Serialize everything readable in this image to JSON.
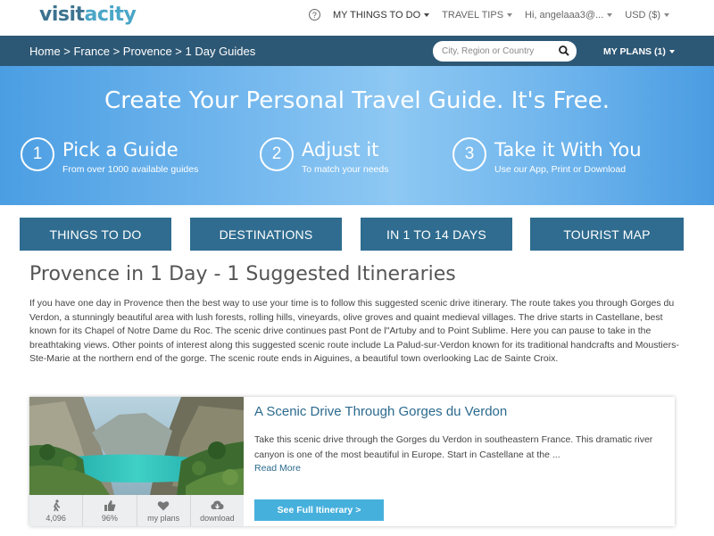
{
  "header": {
    "logo_part1": "visit",
    "logo_part2": "acity",
    "help_icon_glyph": "?",
    "my_things": "MY THINGS TO DO",
    "travel_tips": "TRAVEL TIPS",
    "user": "Hi, angelaaa3@...",
    "currency": "USD ($)"
  },
  "breadcrumb": "Home > France > Provence > 1 Day Guides",
  "search": {
    "placeholder": "City, Region or Country"
  },
  "my_plans": "MY PLANS (1)",
  "hero": {
    "title": "Create Your Personal Travel Guide. It's Free.",
    "steps": [
      {
        "num": "1",
        "title": "Pick a Guide",
        "sub": "From over 1000 available guides"
      },
      {
        "num": "2",
        "title": "Adjust it",
        "sub": "To match your needs"
      },
      {
        "num": "3",
        "title": "Take it With You",
        "sub": "Use our App, Print or Download"
      }
    ]
  },
  "nav": [
    "THINGS TO DO",
    "DESTINATIONS",
    "IN 1 TO 14 DAYS",
    "TOURIST MAP"
  ],
  "page": {
    "title": "Provence in 1 Day - 1 Suggested Itineraries",
    "description": "If you have one day in Provence then the best way to use your time is to follow this suggested scenic drive itinerary. The route takes you through Gorges du Verdon, a stunningly beautiful area with lush forests, rolling hills, vineyards, olive groves and quaint medieval villages. The drive starts in Castellane, best known for its Chapel of Notre Dame du Roc. The scenic drive continues past Pont de l\"Artuby and to Point Sublime. Here you can pause to take in the breathtaking views. Other points of interest along this suggested scenic route include La Palud-sur-Verdon known for its traditional handcrafts and Moustiers-Ste-Marie at the northern end of the gorge. The scenic route ends in Aiguines, a beautiful town overlooking Lac de Sainte Croix."
  },
  "card": {
    "title": "A Scenic Drive Through Gorges du Verdon",
    "blurb": "Take this scenic drive through the Gorges du Verdon in southeastern France. This dramatic river canyon is one of the most beautiful in Europe. Start in Castellane at the ...",
    "read_more": "Read More",
    "button": "See Full Itinerary >",
    "stats": {
      "views": "4,096",
      "likes": "96%",
      "plans": "my plans",
      "download": "download"
    }
  },
  "colors": {
    "header_bar": "#2d5875",
    "nav_button": "#2f6c8f",
    "link": "#2b6a8e",
    "cta": "#46b0dc"
  }
}
